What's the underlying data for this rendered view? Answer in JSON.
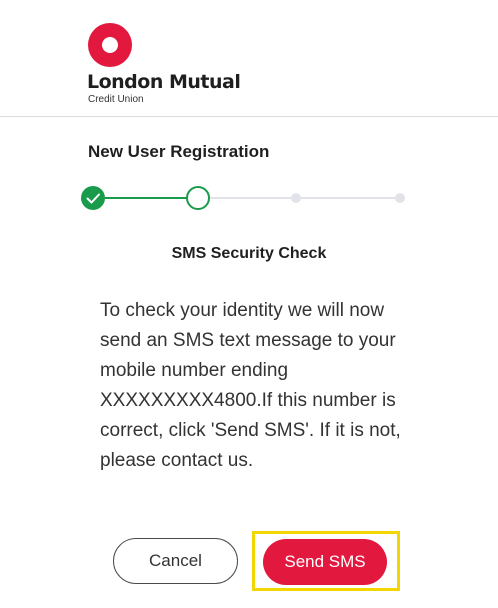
{
  "brand": {
    "name": "London Mutual",
    "sub": "Credit Union",
    "color": "#e3183f"
  },
  "page": {
    "title": "New User Registration"
  },
  "stepper": {
    "total_steps": 4,
    "completed_steps": 1,
    "current_step": 2,
    "active_color": "#1a9b4b",
    "inactive_color": "#e1e3e8"
  },
  "section": {
    "title": "SMS Security Check"
  },
  "message": {
    "text": "To check your identity we will now send an SMS text message to your mobile number ending XXXXXXXXX4800.If this number is correct, click 'Send SMS'. If it is not, please contact us."
  },
  "actions": {
    "cancel_label": "Cancel",
    "send_label": "Send SMS",
    "highlight_color": "#f2d600"
  }
}
